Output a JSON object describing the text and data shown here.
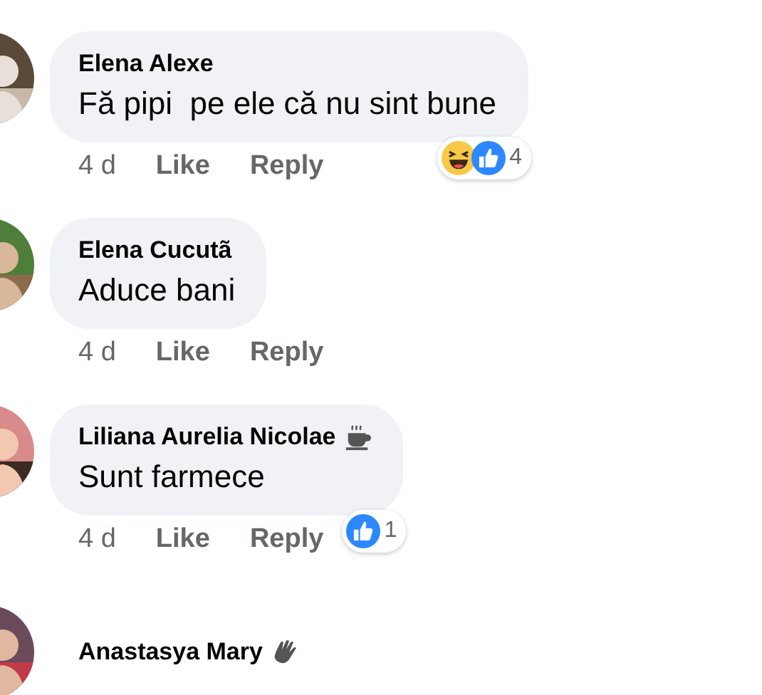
{
  "comments": [
    {
      "author": "Elena Alexe",
      "text": "Fă pipi  pe ele că nu sint bune",
      "time": "4 d",
      "actions": [
        "Like",
        "Reply"
      ],
      "reactions": {
        "icons": [
          {
            "kind": "haha"
          },
          {
            "kind": "like"
          }
        ],
        "count": "4"
      }
    },
    {
      "author": "Elena Cucutã",
      "text": "Aduce bani",
      "time": "4 d",
      "actions": [
        "Like",
        "Reply"
      ]
    },
    {
      "author": "Liliana Aurelia Nicolae",
      "badge": {
        "kind": "coffee"
      },
      "text": "Sunt farmece",
      "time": "4 d",
      "actions": [
        "Like",
        "Reply"
      ],
      "reactions": {
        "icons": [
          {
            "kind": "like"
          }
        ],
        "count": "1"
      }
    },
    {
      "author": "Anastasya Mary",
      "badge": {
        "kind": "wave"
      }
    }
  ]
}
